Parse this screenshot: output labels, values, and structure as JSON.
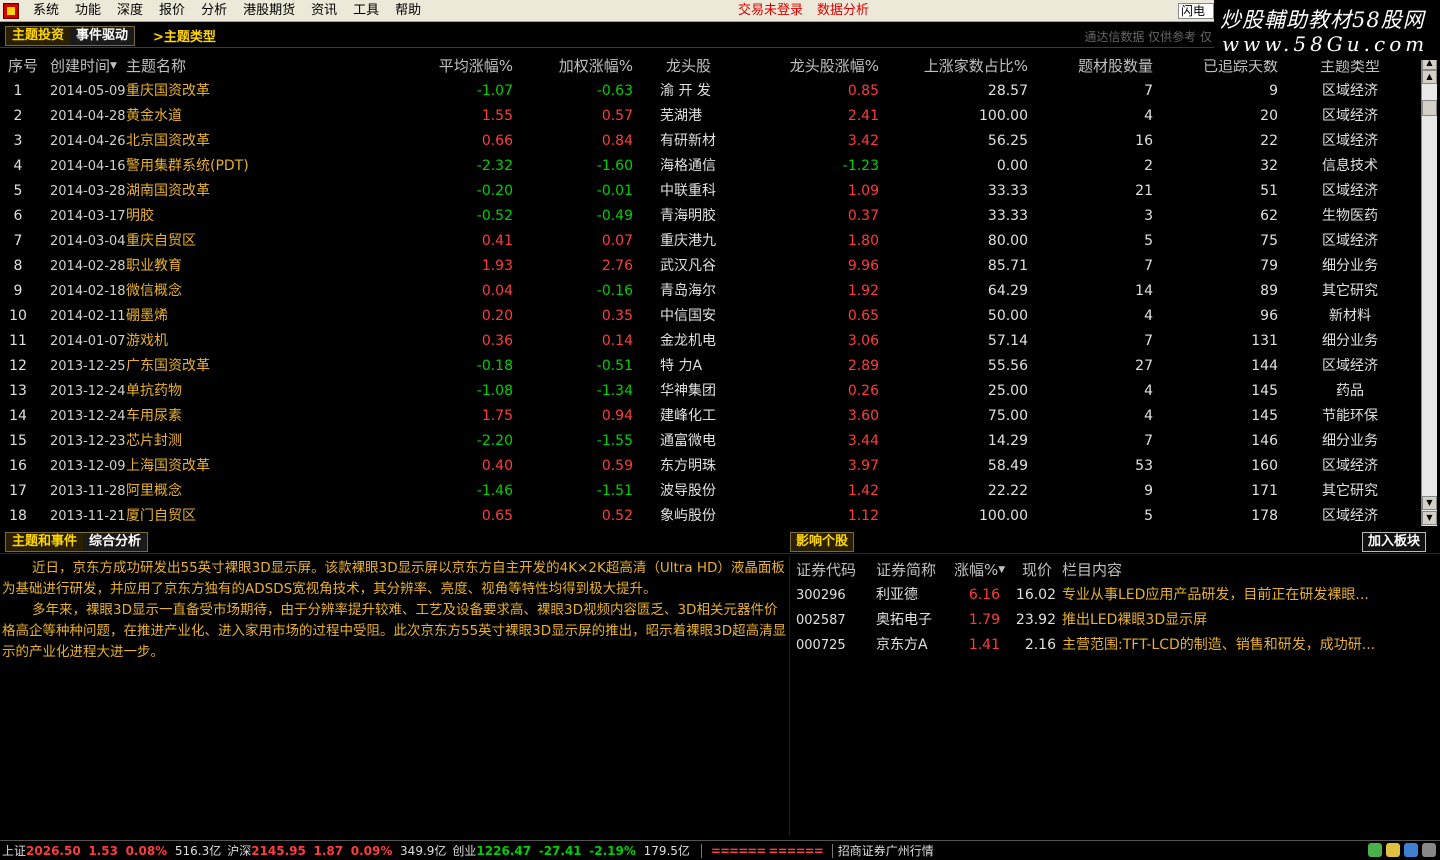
{
  "menu": {
    "items": [
      "系统",
      "功能",
      "深度",
      "报价",
      "分析",
      "港股期货",
      "资讯",
      "工具",
      "帮助"
    ],
    "trade_login": "交易未登录",
    "data_analysis": "数据分析",
    "flash_label": "闪电手"
  },
  "watermark": {
    "line1": "炒股輔助教材58股网",
    "line2": "www.58Gu.com"
  },
  "top_tabs": {
    "theme_invest": "主题投资",
    "event_driven": "事件驱动",
    "theme_type": ">主题类型",
    "status_note": "通达信数据 仅供参考 仅"
  },
  "table": {
    "headers": {
      "seq": "序号",
      "date": "创建时间",
      "name": "主题名称",
      "avg": "平均涨幅%",
      "wavg": "加权涨幅%",
      "leader": "龙头股",
      "leader_pct": "龙头股涨幅%",
      "ratio": "上涨家数占比%",
      "count": "题材股数量",
      "days": "已追踪天数",
      "type": "主题类型"
    },
    "rows": [
      {
        "seq": "1",
        "date": "2014-05-09",
        "name": "重庆国资改革",
        "avg": "-1.07",
        "wavg": "-0.63",
        "leader": "渝 开 发",
        "lpct": "0.85",
        "ratio": "28.57",
        "count": "7",
        "days": "9",
        "type": "区域经济"
      },
      {
        "seq": "2",
        "date": "2014-04-28",
        "name": "黄金水道",
        "avg": "1.55",
        "wavg": "0.57",
        "leader": "芜湖港",
        "lpct": "2.41",
        "ratio": "100.00",
        "count": "4",
        "days": "20",
        "type": "区域经济"
      },
      {
        "seq": "3",
        "date": "2014-04-26",
        "name": "北京国资改革",
        "avg": "0.66",
        "wavg": "0.84",
        "leader": "有研新材",
        "lpct": "3.42",
        "ratio": "56.25",
        "count": "16",
        "days": "22",
        "type": "区域经济"
      },
      {
        "seq": "4",
        "date": "2014-04-16",
        "name": "警用集群系统(PDT)",
        "avg": "-2.32",
        "wavg": "-1.60",
        "leader": "海格通信",
        "lpct": "-1.23",
        "ratio": "0.00",
        "count": "2",
        "days": "32",
        "type": "信息技术"
      },
      {
        "seq": "5",
        "date": "2014-03-28",
        "name": "湖南国资改革",
        "avg": "-0.20",
        "wavg": "-0.01",
        "leader": "中联重科",
        "lpct": "1.09",
        "ratio": "33.33",
        "count": "21",
        "days": "51",
        "type": "区域经济"
      },
      {
        "seq": "6",
        "date": "2014-03-17",
        "name": "明胶",
        "avg": "-0.52",
        "wavg": "-0.49",
        "leader": "青海明胶",
        "lpct": "0.37",
        "ratio": "33.33",
        "count": "3",
        "days": "62",
        "type": "生物医药"
      },
      {
        "seq": "7",
        "date": "2014-03-04",
        "name": "重庆自贸区",
        "avg": "0.41",
        "wavg": "0.07",
        "leader": "重庆港九",
        "lpct": "1.80",
        "ratio": "80.00",
        "count": "5",
        "days": "75",
        "type": "区域经济"
      },
      {
        "seq": "8",
        "date": "2014-02-28",
        "name": "职业教育",
        "avg": "1.93",
        "wavg": "2.76",
        "leader": "武汉凡谷",
        "lpct": "9.96",
        "ratio": "85.71",
        "count": "7",
        "days": "79",
        "type": "细分业务"
      },
      {
        "seq": "9",
        "date": "2014-02-18",
        "name": "微信概念",
        "avg": "0.04",
        "wavg": "-0.16",
        "leader": "青岛海尔",
        "lpct": "1.92",
        "ratio": "64.29",
        "count": "14",
        "days": "89",
        "type": "其它研究"
      },
      {
        "seq": "10",
        "date": "2014-02-11",
        "name": "硼墨烯",
        "avg": "0.20",
        "wavg": "0.35",
        "leader": "中信国安",
        "lpct": "0.65",
        "ratio": "50.00",
        "count": "4",
        "days": "96",
        "type": "新材料"
      },
      {
        "seq": "11",
        "date": "2014-01-07",
        "name": "游戏机",
        "avg": "0.36",
        "wavg": "0.14",
        "leader": "金龙机电",
        "lpct": "3.06",
        "ratio": "57.14",
        "count": "7",
        "days": "131",
        "type": "细分业务"
      },
      {
        "seq": "12",
        "date": "2013-12-25",
        "name": "广东国资改革",
        "avg": "-0.18",
        "wavg": "-0.51",
        "leader": "特 力A",
        "lpct": "2.89",
        "ratio": "55.56",
        "count": "27",
        "days": "144",
        "type": "区域经济"
      },
      {
        "seq": "13",
        "date": "2013-12-24",
        "name": "单抗药物",
        "avg": "-1.08",
        "wavg": "-1.34",
        "leader": "华神集团",
        "lpct": "0.26",
        "ratio": "25.00",
        "count": "4",
        "days": "145",
        "type": "药品"
      },
      {
        "seq": "14",
        "date": "2013-12-24",
        "name": "车用尿素",
        "avg": "1.75",
        "wavg": "0.94",
        "leader": "建峰化工",
        "lpct": "3.60",
        "ratio": "75.00",
        "count": "4",
        "days": "145",
        "type": "节能环保"
      },
      {
        "seq": "15",
        "date": "2013-12-23",
        "name": "芯片封测",
        "avg": "-2.20",
        "wavg": "-1.55",
        "leader": "通富微电",
        "lpct": "3.44",
        "ratio": "14.29",
        "count": "7",
        "days": "146",
        "type": "细分业务"
      },
      {
        "seq": "16",
        "date": "2013-12-09",
        "name": "上海国资改革",
        "avg": "0.40",
        "wavg": "0.59",
        "leader": "东方明珠",
        "lpct": "3.97",
        "ratio": "58.49",
        "count": "53",
        "days": "160",
        "type": "区域经济"
      },
      {
        "seq": "17",
        "date": "2013-11-28",
        "name": "阿里概念",
        "avg": "-1.46",
        "wavg": "-1.51",
        "leader": "波导股份",
        "lpct": "1.42",
        "ratio": "22.22",
        "count": "9",
        "days": "171",
        "type": "其它研究"
      },
      {
        "seq": "18",
        "date": "2013-11-21",
        "name": "厦门自贸区",
        "avg": "0.65",
        "wavg": "0.52",
        "leader": "象屿股份",
        "lpct": "1.12",
        "ratio": "100.00",
        "count": "5",
        "days": "178",
        "type": "区域经济"
      }
    ]
  },
  "lower": {
    "tab_theme_event": "主题和事件",
    "tab_analysis": "综合分析",
    "influence_tab": "影响个股",
    "add_block": "加入板块",
    "article": [
      "近日，京东方成功研发出55英寸裸眼3D显示屏。该款裸眼3D显示屏以京东方自主开发的4K×2K超高清（Ultra HD）液晶面板为基础进行研发，并应用了京东方独有的ADSDS宽视角技术，其分辨率、亮度、视角等特性均得到极大提升。",
      "多年来，裸眼3D显示一直备受市场期待，由于分辨率提升较难、工艺及设备要求高、裸眼3D视频内容匮乏、3D相关元器件价格高企等种种问题，在推进产业化、进入家用市场的过程中受阻。此次京东方55英寸裸眼3D显示屏的推出，昭示着裸眼3D超高清显示的产业化进程大进一步。"
    ],
    "stock_headers": {
      "code": "证券代码",
      "name": "证券简称",
      "pct": "涨幅%",
      "price": "现价",
      "desc": "栏目内容"
    },
    "stocks": [
      {
        "code": "300296",
        "name": "利亚德",
        "pct": "6.16",
        "price": "16.02",
        "desc": "专业从事LED应用产品研发，目前正在研发裸眼..."
      },
      {
        "code": "002587",
        "name": "奥拓电子",
        "pct": "1.79",
        "price": "23.92",
        "desc": "推出LED裸眼3D显示屏"
      },
      {
        "code": "000725",
        "name": "京东方A",
        "pct": "1.41",
        "price": "2.16",
        "desc": "主营范围:TFT-LCD的制造、销售和研发，成功研..."
      }
    ]
  },
  "statusbar": {
    "sh_label": "上证",
    "sh_val": "2026.50",
    "sh_chg": "1.53",
    "sh_pct": "0.08%",
    "sh_amt": "516.3亿",
    "hs_label": "沪深",
    "hs_val": "2145.95",
    "hs_chg": "1.87",
    "hs_pct": "0.09%",
    "hs_amt": "349.9亿",
    "cy_label": "创业",
    "cy_val": "1226.47",
    "cy_chg": "-27.41",
    "cy_pct": "-2.19%",
    "cy_amt": "179.5亿",
    "bars": "====== ======",
    "broker": "招商证券广州行情"
  },
  "colors": {
    "up": "#ff3c3c",
    "down": "#00d000",
    "name": "#e8b030",
    "accent": "#ffd700"
  }
}
